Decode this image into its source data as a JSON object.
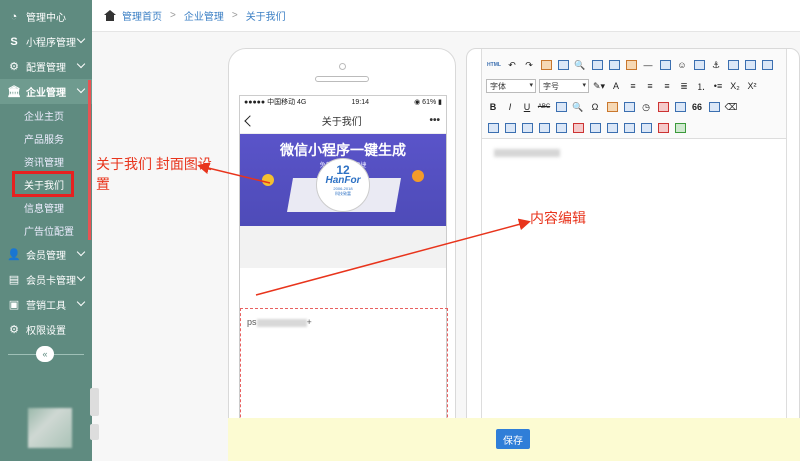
{
  "sidebar": {
    "items": [
      {
        "label": "管理中心",
        "icon": "dashboard-icon"
      },
      {
        "label": "小程序管理",
        "icon": "s-logo-icon"
      },
      {
        "label": "配置管理",
        "icon": "gears-icon"
      },
      {
        "label": "企业管理",
        "icon": "bank-icon"
      },
      {
        "label": "会员管理",
        "icon": "user-icon"
      },
      {
        "label": "会员卡管理",
        "icon": "id-card-icon"
      },
      {
        "label": "营销工具",
        "icon": "briefcase-icon"
      },
      {
        "label": "权限设置",
        "icon": "gear-icon"
      }
    ],
    "sub_items": [
      "企业主页",
      "产品服务",
      "资讯管理",
      "关于我们",
      "信息管理",
      "广告位配置"
    ]
  },
  "breadcrumb": [
    "管理首页",
    "企业管理",
    "关于我们"
  ],
  "phone": {
    "carrier": "●●●●● 中国移动  4G",
    "time": "19:14",
    "battery": "◉ 61% ▮",
    "title": "关于我们",
    "more": "•••",
    "banner_title": "微信小程序一键生成",
    "banner_sub": "免费 · 高效 · 便捷",
    "logo_num": "12",
    "logo_text": "HanFor",
    "logo_years": "2006-2018",
    "logo_tag": "科技致富",
    "content_prefix": "ps",
    "content_suffix": "+"
  },
  "editor": {
    "html_label": "HTML",
    "font_family": "字体",
    "font_size": "字号",
    "bold": "B",
    "italic": "I",
    "underline": "U",
    "strike": "ABC",
    "quote": "66",
    "omega": "Ω",
    "subscript": "X₂",
    "superscript": "X²",
    "font_color": "A"
  },
  "footer": {
    "save_label": "保存"
  },
  "annotations": {
    "cover_note": "关于我们  封面图设置",
    "content_note": "内容编辑"
  },
  "colors": {
    "sidebar": "#5f8b80",
    "accent": "#2f7ed8",
    "annotation": "#e8341c",
    "footer": "#fcfbd2"
  }
}
